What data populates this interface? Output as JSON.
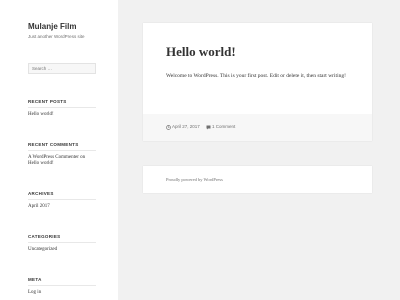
{
  "site": {
    "title": "Mulanje Film",
    "description": "Just another WordPress site"
  },
  "search": {
    "placeholder": "Search …"
  },
  "widgets": {
    "recent_posts": {
      "title": "RECENT POSTS",
      "items": [
        "Hello world!"
      ]
    },
    "recent_comments": {
      "title": "RECENT COMMENTS",
      "line1": "A WordPress Commenter on",
      "line2": "Hello world!"
    },
    "archives": {
      "title": "ARCHIVES",
      "items": [
        "April 2017"
      ]
    },
    "categories": {
      "title": "CATEGORIES",
      "items": [
        "Uncategorized"
      ]
    },
    "meta": {
      "title": "META",
      "items": [
        "Log in"
      ]
    }
  },
  "post": {
    "title": "Hello world!",
    "body": "Welcome to WordPress. This is your first post. Edit or delete it, then start writing!",
    "date": "April 27, 2017",
    "comments": "1 Comment"
  },
  "footer": {
    "powered": "Proudly powered by WordPress"
  },
  "icons": {
    "date": "clock-icon",
    "comments": "comment-bubble-icon"
  }
}
